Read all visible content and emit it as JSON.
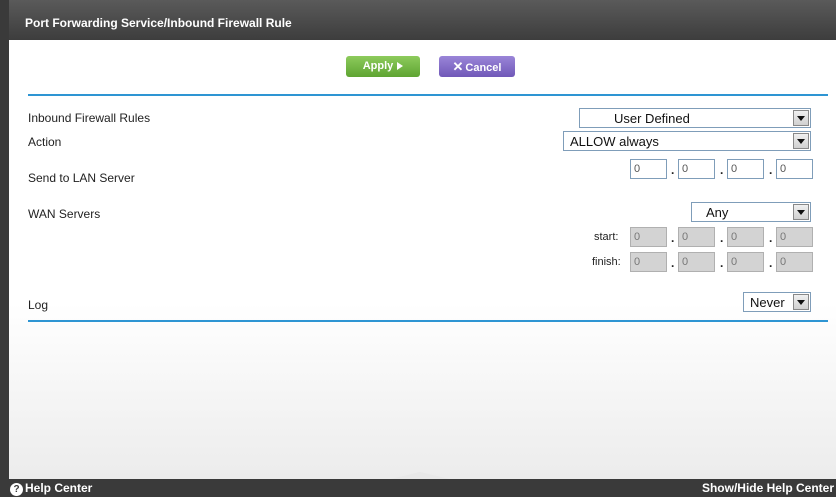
{
  "header": {
    "title": "Port Forwarding Service/Inbound Firewall Rule"
  },
  "toolbar": {
    "apply_label": "Apply",
    "cancel_label": "Cancel"
  },
  "form": {
    "inbound_rules": {
      "label": "Inbound Firewall Rules",
      "value": "User Defined"
    },
    "action": {
      "label": "Action",
      "value": "ALLOW always"
    },
    "send_to_lan": {
      "label": "Send to LAN Server",
      "ip": [
        "0",
        "0",
        "0",
        "0"
      ]
    },
    "wan_servers": {
      "label": "WAN Servers",
      "value": "Any",
      "start_label": "start:",
      "start_ip": [
        "0",
        "0",
        "0",
        "0"
      ],
      "finish_label": "finish:",
      "finish_ip": [
        "0",
        "0",
        "0",
        "0"
      ]
    },
    "log": {
      "label": "Log",
      "value": "Never"
    }
  },
  "footer": {
    "help_center": "Help Center",
    "toggle_help": "Show/Hide Help Center"
  },
  "colors": {
    "accent_rule": "#2e95d3",
    "apply": "#6db33f",
    "cancel": "#7b61c4"
  }
}
